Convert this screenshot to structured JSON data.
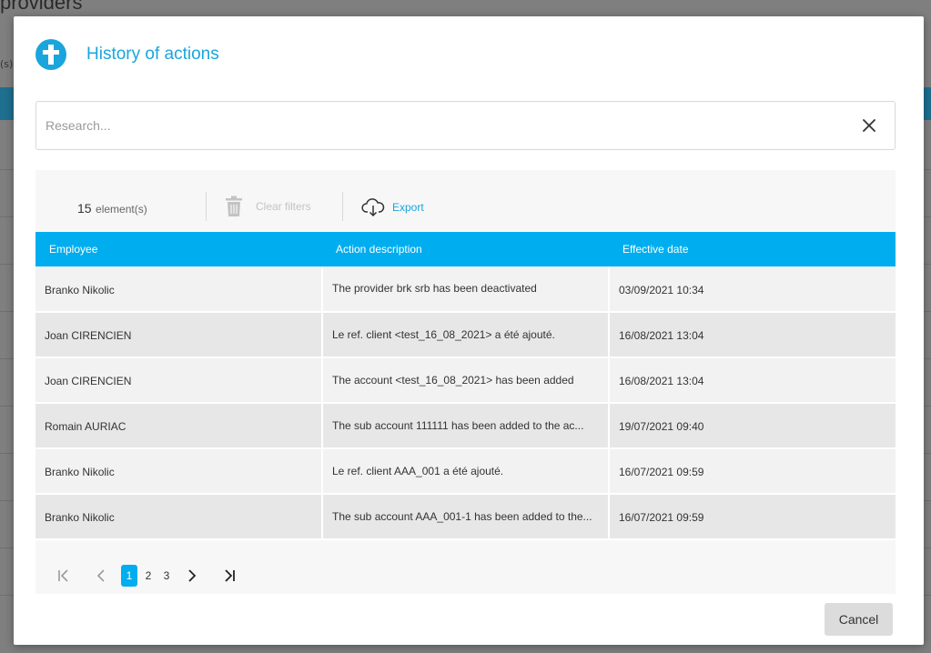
{
  "background": {
    "title": "providers",
    "count_fragment": "(s)"
  },
  "modal": {
    "title": "History of actions",
    "header_icon": "tombstone-cross-icon",
    "search": {
      "placeholder": "Research...",
      "value": ""
    },
    "toolbar": {
      "count_number": "15",
      "count_label": "element(s)",
      "clear_filters_label": "Clear filters",
      "export_label": "Export"
    },
    "table": {
      "columns": [
        "Employee",
        "Action description",
        "Effective date"
      ],
      "rows": [
        {
          "employee": "Branko Nikolic",
          "description": "The provider brk srb has been deactivated",
          "date": "03/09/2021 10:34"
        },
        {
          "employee": "Joan CIRENCIEN",
          "description": "Le ref. client <test_16_08_2021> a été ajouté.",
          "date": "16/08/2021 13:04"
        },
        {
          "employee": "Joan CIRENCIEN",
          "description": "The account <test_16_08_2021> has been added",
          "date": "16/08/2021 13:04"
        },
        {
          "employee": "Romain AURIAC",
          "description": "The sub account 111111 has been added to the ac...",
          "date": "19/07/2021 09:40"
        },
        {
          "employee": "Branko Nikolic",
          "description": "Le ref. client AAA_001 a été ajouté.",
          "date": "16/07/2021 09:59"
        },
        {
          "employee": "Branko Nikolic",
          "description": "The sub account AAA_001-1 has been added to the...",
          "date": "16/07/2021 09:59"
        }
      ]
    },
    "pagination": {
      "pages": [
        "1",
        "2",
        "3"
      ],
      "current": "1"
    },
    "cancel_label": "Cancel"
  },
  "colors": {
    "accent": "#00adef",
    "title": "#1aa5dd",
    "overlay": "#7f7f7f"
  }
}
